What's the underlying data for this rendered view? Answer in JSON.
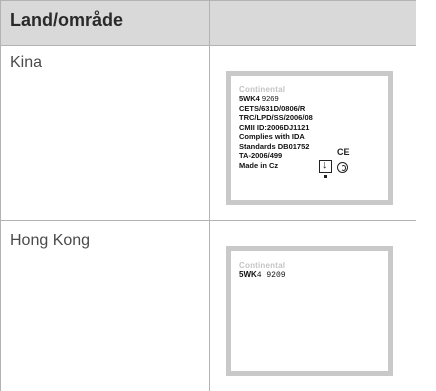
{
  "table": {
    "header": {
      "col1": "Land/område",
      "col2": ""
    },
    "rows": [
      {
        "region": "Kina",
        "label": {
          "brand": "Continental",
          "lines": [
            {
              "bold": "5WK4",
              "thin": " 9269"
            },
            {
              "bold": "CETS/631D/0806/R",
              "thin": ""
            },
            {
              "bold": "TRC/LPD/SS/2006/08",
              "thin": ""
            },
            {
              "bold": "CMII ID:2006DJ1121",
              "thin": ""
            },
            {
              "bold": "Complies with IDA",
              "thin": ""
            },
            {
              "bold": "Standards DB01752",
              "thin": ""
            },
            {
              "bold": "TA-2006/499",
              "thin": ""
            },
            {
              "bold": "Made in Cz",
              "thin": ""
            }
          ],
          "ce_mark": "CE"
        }
      },
      {
        "region": "Hong Kong",
        "label": {
          "brand": "Continental",
          "code_bold": "5WK",
          "code_rest": "4 9209"
        }
      }
    ]
  }
}
